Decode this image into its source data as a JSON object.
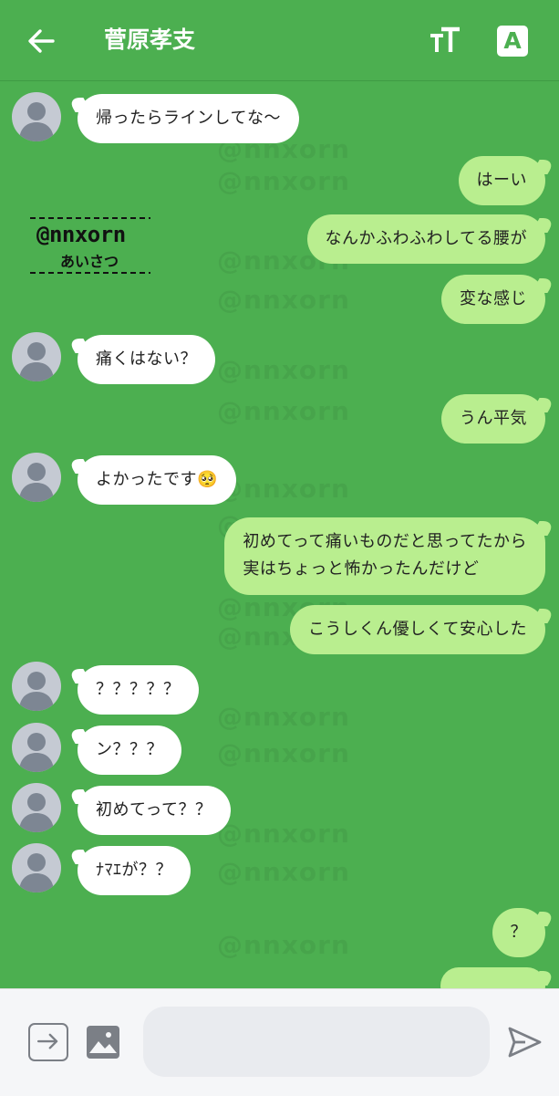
{
  "header": {
    "title": "菅原孝支",
    "back_icon": "arrow-left-icon",
    "text_size_icon": "text-size-icon",
    "translate_label": "A"
  },
  "watermark_text": "@nnxorn",
  "stamp": {
    "line1": "@nnxorn",
    "line2": "あいさつ"
  },
  "messages": [
    {
      "side": "in",
      "text": "帰ったらラインしてな〜"
    },
    {
      "side": "out",
      "text": "はーい"
    },
    {
      "side": "out",
      "text": "なんかふわふわしてる腰が"
    },
    {
      "side": "out",
      "text": "変な感じ"
    },
    {
      "side": "in",
      "text": "痛くはない？"
    },
    {
      "side": "out",
      "text": "うん平気"
    },
    {
      "side": "in",
      "text": "よかったです🥺"
    },
    {
      "side": "out",
      "text": "初めてって痛いものだと思ってたから"
    },
    {
      "side": "out",
      "text": "実はちょっと怖かったんだけど"
    },
    {
      "side": "out",
      "text": "こうしくん優しくて安心した"
    },
    {
      "side": "in",
      "text": "？？？？？"
    },
    {
      "side": "in",
      "text": "ン？？？"
    },
    {
      "side": "in",
      "text": "初めてって？？"
    },
    {
      "side": "in",
      "text": "ﾅﾏｴが？？"
    },
    {
      "side": "out",
      "text": "？"
    }
  ],
  "input_bar": {
    "placeholder": "",
    "icons": [
      "arrow-right-icon",
      "image-icon",
      "send-icon"
    ]
  }
}
